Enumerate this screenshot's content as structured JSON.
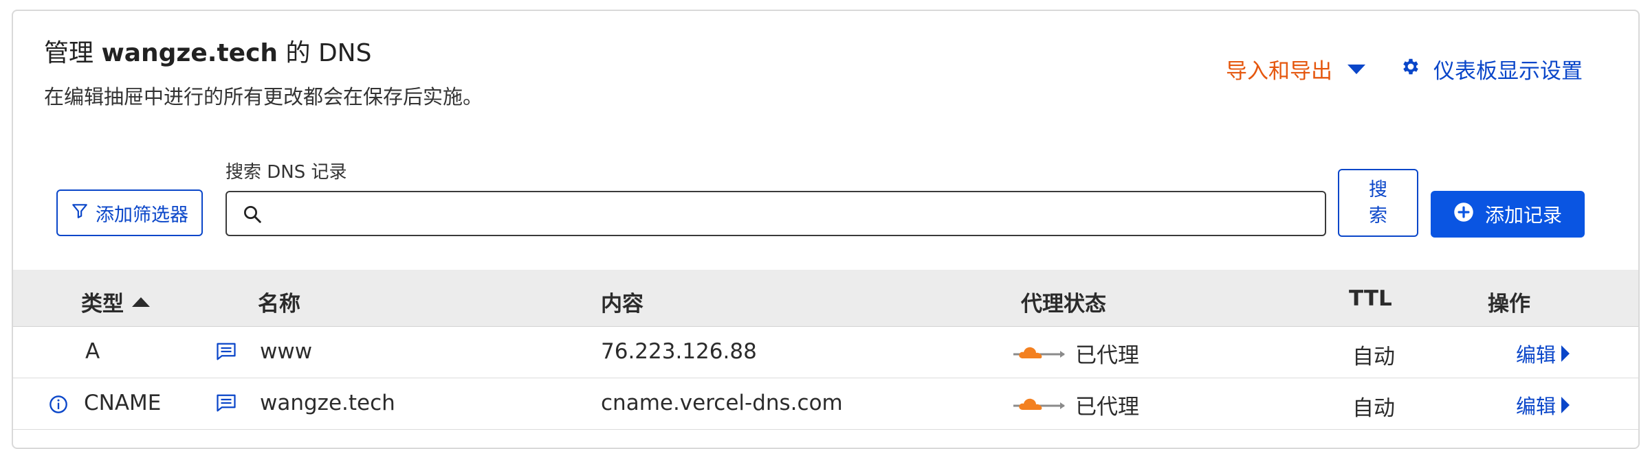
{
  "header": {
    "title_prefix": "管理",
    "domain": "wangze.tech",
    "title_suffix": "的 DNS",
    "subtitle": "在编辑抽屉中进行的所有更改都会在保存后实施。",
    "import_export_label": "导入和导出",
    "dashboard_settings_label": "仪表板显示设置"
  },
  "toolbar": {
    "filter_label": "添加筛选器",
    "search_label": "搜索 DNS 记录",
    "search_value": "",
    "search_button_label": "搜索",
    "add_record_label": "添加记录"
  },
  "table": {
    "columns": {
      "type": "类型",
      "name": "名称",
      "content": "内容",
      "proxy": "代理状态",
      "ttl": "TTL",
      "actions": "操作"
    },
    "rows": [
      {
        "type": "A",
        "name": "www",
        "content": "76.223.126.88",
        "proxy": "已代理",
        "ttl": "自动",
        "action": "编辑",
        "has_info": false
      },
      {
        "type": "CNAME",
        "name": "wangze.tech",
        "content": "cname.vercel-dns.com",
        "proxy": "已代理",
        "ttl": "自动",
        "action": "编辑",
        "has_info": true
      }
    ]
  },
  "colors": {
    "link_blue": "#0a46c9",
    "primary_button": "#0a55e2",
    "accent_orange": "#e5570e",
    "cloud_orange": "#f38020"
  },
  "icons": [
    "chevron-down-icon",
    "gear-icon",
    "filter-icon",
    "search-icon",
    "plus-circle-icon",
    "sort-asc-icon",
    "comment-icon",
    "info-icon",
    "proxied-cloud-icon",
    "chevron-right-icon"
  ]
}
